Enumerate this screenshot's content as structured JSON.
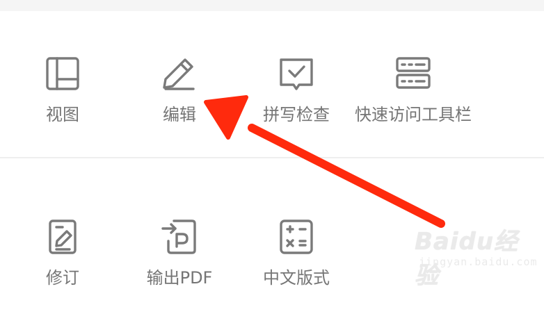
{
  "toolbar": {
    "row1": [
      {
        "label": "视图",
        "icon": "layout-icon"
      },
      {
        "label": "编辑",
        "icon": "pencil-icon"
      },
      {
        "label": "拼写检查",
        "icon": "spell-check-icon"
      },
      {
        "label": "快速访问工具栏",
        "icon": "server-rack-icon"
      }
    ],
    "row2": [
      {
        "label": "修订",
        "icon": "revision-icon"
      },
      {
        "label": "输出PDF",
        "icon": "export-pdf-icon"
      },
      {
        "label": "中文版式",
        "icon": "calculator-icon"
      }
    ]
  },
  "watermark": {
    "brand": "Baidu经验",
    "sub": "jingyan.baidu.com"
  },
  "colors": {
    "icon_stroke": "#7a7a7a",
    "label_text": "#757575",
    "arrow": "#ff2a0d",
    "top_strip": "#f5f5f5",
    "divider": "#eeeeee"
  }
}
